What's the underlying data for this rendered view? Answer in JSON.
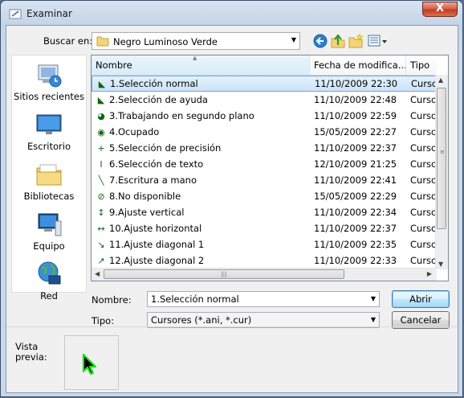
{
  "window": {
    "title": "Examinar",
    "close_label": "X"
  },
  "toolbar": {
    "lookin_label": "Buscar en:",
    "lookin_value": "Negro Luminoso Verde",
    "buttons": [
      "back-arrow",
      "up-folder",
      "new-folder",
      "views-menu"
    ]
  },
  "places": [
    {
      "label": "Sitios recientes",
      "icon": "recent-places-icon"
    },
    {
      "label": "Escritorio",
      "icon": "desktop-icon"
    },
    {
      "label": "Bibliotecas",
      "icon": "libraries-icon"
    },
    {
      "label": "Equipo",
      "icon": "computer-icon"
    },
    {
      "label": "Red",
      "icon": "network-icon"
    }
  ],
  "columns": {
    "name": "Nombre",
    "date": "Fecha de modifica...",
    "type": "Tipo"
  },
  "files": [
    {
      "name": "1.Selección normal",
      "date": "11/10/2009 22:30",
      "type": "Cursor",
      "selected": true,
      "glyph": "◣"
    },
    {
      "name": "2.Selección de ayuda",
      "date": "11/10/2009 22:48",
      "type": "Cursor",
      "glyph": "◣"
    },
    {
      "name": "3.Trabajando en segundo plano",
      "date": "11/10/2009 22:59",
      "type": "Cursor",
      "glyph": "◕"
    },
    {
      "name": "4.Ocupado",
      "date": "15/05/2009 22:27",
      "type": "Cursor",
      "glyph": "◉"
    },
    {
      "name": "5.Selección de precisión",
      "date": "11/10/2009 22:37",
      "type": "Cursor",
      "glyph": "+"
    },
    {
      "name": "6.Selección de texto",
      "date": "12/10/2009 21:25",
      "type": "Cursor",
      "glyph": "I"
    },
    {
      "name": "7.Escritura a mano",
      "date": "11/10/2009 22:41",
      "type": "Cursor",
      "glyph": "╲"
    },
    {
      "name": "8.No disponible",
      "date": "15/05/2009 22:29",
      "type": "Cursor",
      "glyph": "⊘"
    },
    {
      "name": "9.Ajuste vertical",
      "date": "11/10/2009 22:34",
      "type": "Cursor",
      "glyph": "↕"
    },
    {
      "name": "10.Ajuste horizontal",
      "date": "11/10/2009 22:37",
      "type": "Cursor",
      "glyph": "↔"
    },
    {
      "name": "11.Ajuste diagonal 1",
      "date": "11/10/2009 22:35",
      "type": "Cursor",
      "glyph": "↘"
    },
    {
      "name": "12.Ajuste diagonal 2",
      "date": "11/10/2009 22:33",
      "type": "Cursor",
      "glyph": "↗"
    }
  ],
  "filename": {
    "label": "Nombre:",
    "value": "1.Selección normal"
  },
  "filetype": {
    "label": "Tipo:",
    "value": "Cursores (*.ani, *.cur)"
  },
  "buttons": {
    "open": "Abrir",
    "cancel": "Cancelar"
  },
  "preview": {
    "label_line1": "Vista",
    "label_line2": "previa:"
  },
  "colors": {
    "accent_green": "#0a8a0a",
    "selection": "#cbe4f7"
  }
}
